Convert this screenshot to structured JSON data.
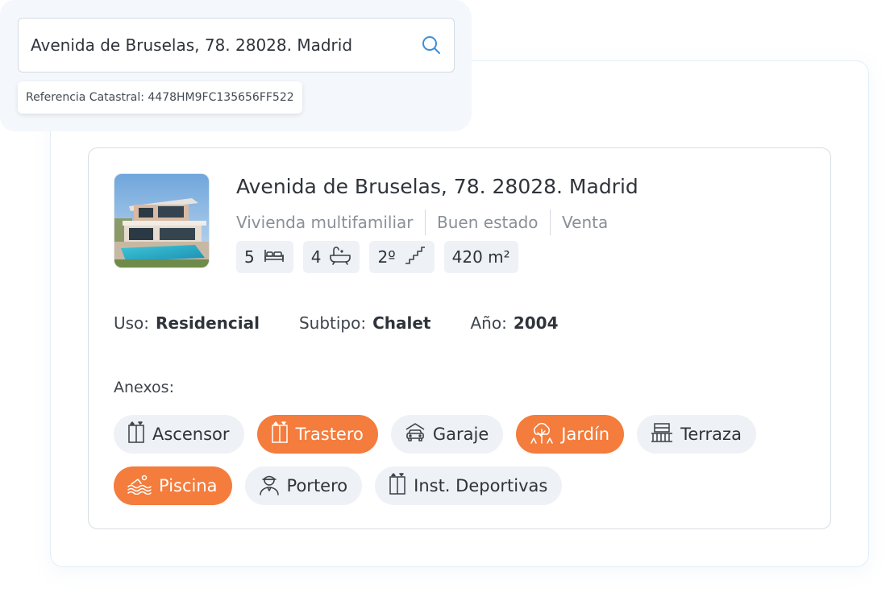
{
  "search": {
    "value": "Avenida de Bruselas, 78. 28028. Madrid",
    "placeholder": "Avenida de Bruselas, 78. 28028. Madrid",
    "cadastral_reference": "Referencia Catastral: 4478HM9FC135656FF522"
  },
  "property": {
    "title": "Avenida de Bruselas, 78. 28028. Madrid",
    "type": "Vivienda multifamiliar",
    "condition": "Buen estado",
    "operation": "Venta",
    "stats": [
      {
        "value": "5",
        "icon": "bed-icon"
      },
      {
        "value": "4",
        "icon": "bathtub-icon"
      },
      {
        "value": "2º",
        "icon": "stairs-icon"
      },
      {
        "value": "420 m²",
        "icon": ""
      }
    ],
    "facts": [
      {
        "label": "Uso:",
        "value": "Residencial"
      },
      {
        "label": "Subtipo:",
        "value": "Chalet"
      },
      {
        "label": "Año:",
        "value": "2004"
      }
    ],
    "anexos_label": "Anexos:",
    "anexos": [
      {
        "label": "Ascensor",
        "icon": "elevator-icon",
        "active": false
      },
      {
        "label": "Trastero",
        "icon": "storage-icon",
        "active": true
      },
      {
        "label": "Garaje",
        "icon": "car-icon",
        "active": false
      },
      {
        "label": "Jardín",
        "icon": "tree-icon",
        "active": true
      },
      {
        "label": "Terraza",
        "icon": "terrace-icon",
        "active": false
      },
      {
        "label": "Piscina",
        "icon": "pool-icon",
        "active": true
      },
      {
        "label": "Portero",
        "icon": "doorman-icon",
        "active": false
      },
      {
        "label": "Inst. Deportivas",
        "icon": "sports-icon",
        "active": false
      }
    ]
  },
  "colors": {
    "accent": "#f47c3c",
    "chip_bg": "#eef1f5",
    "search_icon": "#3b8fd9"
  }
}
